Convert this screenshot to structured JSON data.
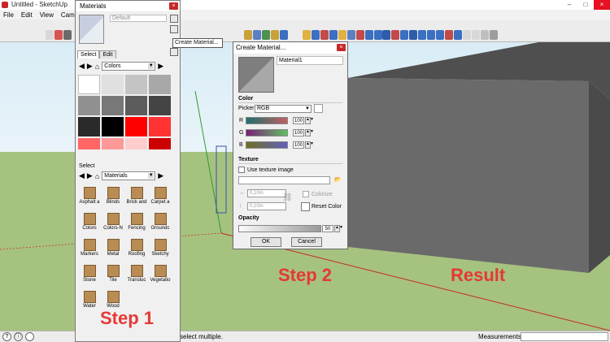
{
  "window": {
    "title": "Untitled - SketchUp",
    "close": "×",
    "minimize": "–",
    "maximize": "□"
  },
  "menu": [
    "File",
    "Edit",
    "View",
    "Camera"
  ],
  "status": {
    "text": "select multiple.",
    "measurements_label": "Measurements",
    "icon_info": "?",
    "icon_credits": "ⓘ"
  },
  "annotations": {
    "step1": "Step 1",
    "step2": "Step 2",
    "result": "Result"
  },
  "materials_panel": {
    "title": "Materials",
    "close": "×",
    "name_value": "Default",
    "tooltip": "Create Material...",
    "tabs": [
      "Select",
      "Edit"
    ],
    "top_dropdown": "Colors",
    "bottom_section_label": "Select",
    "bottom_dropdown": "Materials",
    "nav_back": "◀",
    "nav_forward": "▶",
    "nav_home": "⌂",
    "nav_go": "▶",
    "swatches": [
      "#ffffff",
      "#e0e0e0",
      "#c4c4c4",
      "#a8a8a8",
      "#909090",
      "#787878",
      "#5c5c5c",
      "#444444",
      "#2a2a2a",
      "#000000",
      "#ff0000",
      "#ff3333",
      "#ff6666",
      "#ff9999",
      "#ffcccc",
      "#cc0000"
    ],
    "materials": [
      "Asphalt a",
      "Blinds",
      "Brick and",
      "Carpet a",
      "Colors",
      "Colors-N",
      "Fencing",
      "Groundc",
      "Markers",
      "Metal",
      "Roofing",
      "Sketchy",
      "Stone",
      "Tile",
      "Transluc",
      "Vegetatio",
      "Water",
      "Wood"
    ]
  },
  "dialog": {
    "title": "Create Material...",
    "close": "×",
    "name_value": "Material1",
    "color_section": "Color",
    "picker_label": "Picker:",
    "picker_value": "RGB",
    "r_label": "R",
    "g_label": "G",
    "b_label": "B",
    "r_value": "100",
    "g_value": "100",
    "b_value": "100",
    "texture_section": "Texture",
    "use_texture_label": "Use texture image",
    "width_value": "0,10m",
    "height_value": "0,10m",
    "colorize_label": "Colorize",
    "reset_color_label": "Reset Color",
    "opacity_section": "Opacity",
    "opacity_value": "50",
    "ok_label": "OK",
    "cancel_label": "Cancel"
  }
}
